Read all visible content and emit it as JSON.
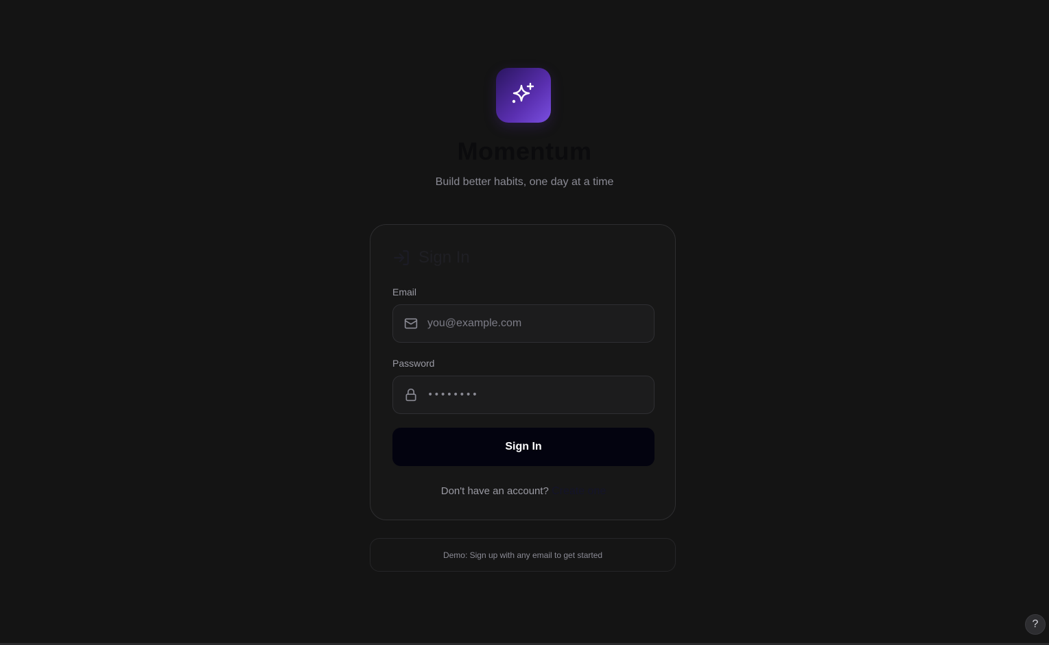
{
  "app": {
    "name": "Momentum",
    "tagline": "Build better habits, one day at a time",
    "logo_icon": "sparkles-icon",
    "brand_gradient": [
      "#2a1560",
      "#5a2fb0",
      "#7a4fe0"
    ]
  },
  "signin_card": {
    "title": "Sign In",
    "title_icon": "log-in-icon",
    "email": {
      "label": "Email",
      "placeholder": "you@example.com",
      "value": "",
      "icon": "mail-icon"
    },
    "password": {
      "label": "Password",
      "masked_value": "••••••••",
      "icon": "lock-icon"
    },
    "submit_label": "Sign In",
    "signup_prompt": "Don't have an account?",
    "signup_link": "Create one"
  },
  "demo_notice": "Demo: Sign up with any email to get started",
  "help": {
    "label": "?",
    "icon": "help-icon"
  }
}
